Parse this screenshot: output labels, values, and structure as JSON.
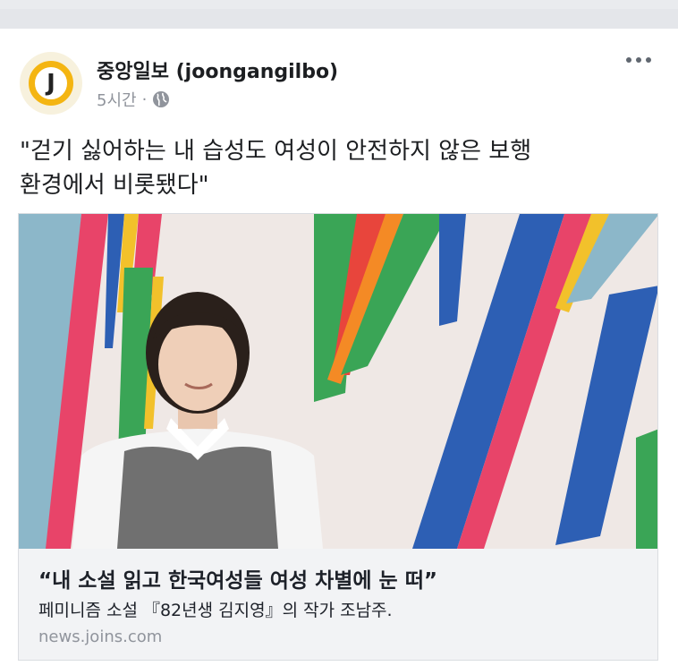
{
  "post": {
    "page_name": "중앙일보 (joongangilbo)",
    "avatar_letter": "J",
    "time": "5시간",
    "separator": "·",
    "audience_icon": "globe-icon",
    "more_icon": "more-options-icon",
    "text_line1": "\"걷기 싫어하는 내 습성도 여성이 안전하지 않은 보행",
    "text_line2": "환경에서 비롯됐다\""
  },
  "link": {
    "title": "“내 소설 읽고 한국여성들 여성 차별에 눈 떠”",
    "description": "페미니즘 소설 『82년생 김지영』의 작가 조남주.",
    "domain": "news.joins.com"
  },
  "colors": {
    "avatar_ring": "#f4b512",
    "background_strip": "#e9ebee",
    "link_info_bg": "#f2f3f5",
    "meta_text": "#90949c"
  }
}
